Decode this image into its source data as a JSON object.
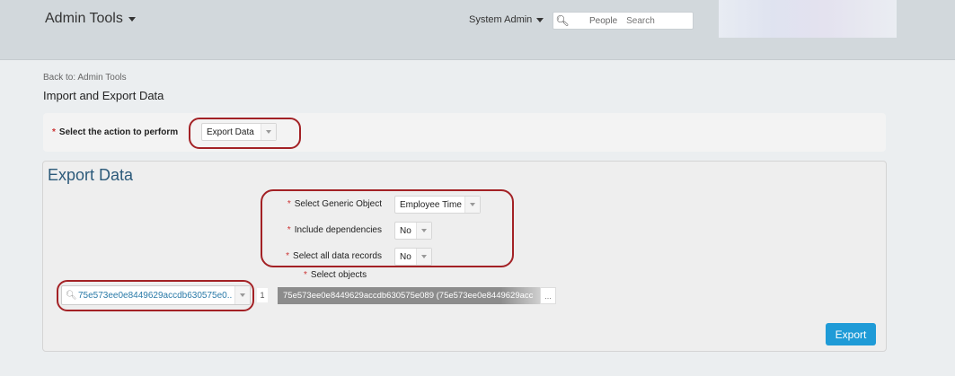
{
  "header": {
    "app_title": "Admin Tools",
    "user_menu": "System Admin",
    "search": {
      "scope": "People",
      "placeholder": "Search"
    }
  },
  "breadcrumb": "Back to: Admin Tools",
  "page_title": "Import and Export Data",
  "action": {
    "label": "Select the action to perform",
    "required_mark": "*",
    "value": "Export Data"
  },
  "export_panel": {
    "title": "Export Data",
    "fields": [
      {
        "label": "Select Generic Object",
        "value": "Employee Time"
      },
      {
        "label": "Include dependencies",
        "value": "No"
      },
      {
        "label": "Select all data records",
        "value": "No"
      }
    ],
    "objects": {
      "label": "Select objects",
      "picker_value": "75e573ee0e8449629accdb630575e0...",
      "count": "1",
      "selected": "75e573ee0e8449629accdb630575e089 (75e573ee0e8449629acc",
      "more": "..."
    },
    "export_button": "Export"
  },
  "colors": {
    "header_bg": "#d2d8dc",
    "panel_bg": "#eeeeee",
    "title_blue": "#2c5a7a",
    "button_blue": "#1f9bd7",
    "required_red": "#cc3333",
    "highlight_red": "#a32125"
  },
  "icons": [
    "caret-down-icon",
    "search-icon",
    "magnifier-icon"
  ]
}
